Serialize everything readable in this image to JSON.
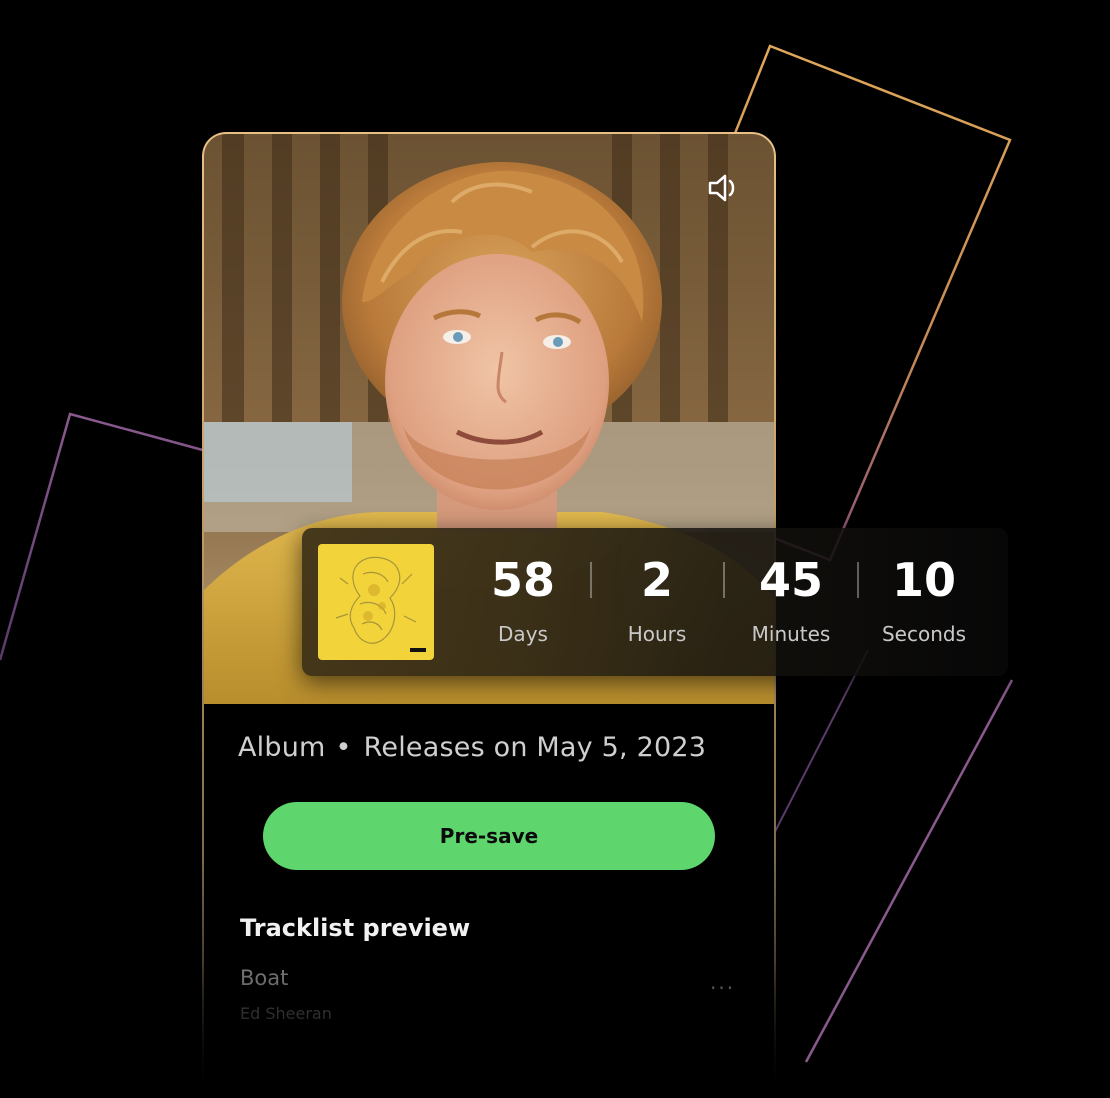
{
  "album": {
    "type_label": "Album",
    "separator": "•",
    "release_text": "Releases on May 5, 2023"
  },
  "countdown": {
    "days": {
      "value": "58",
      "label": "Days"
    },
    "hours": {
      "value": "2",
      "label": "Hours"
    },
    "minutes": {
      "value": "45",
      "label": "Minutes"
    },
    "seconds": {
      "value": "10",
      "label": "Seconds"
    }
  },
  "actions": {
    "presave_label": "Pre-save",
    "sound_icon": "speaker-icon"
  },
  "tracklist": {
    "title": "Tracklist preview",
    "tracks": [
      {
        "title": "Boat",
        "artist": "Ed Sheeran",
        "more": "···"
      }
    ]
  },
  "colors": {
    "presave_green": "#5fd56e",
    "card_border_gold": "#e7c087",
    "album_yellow": "#f2d43a",
    "background": "#000000"
  }
}
